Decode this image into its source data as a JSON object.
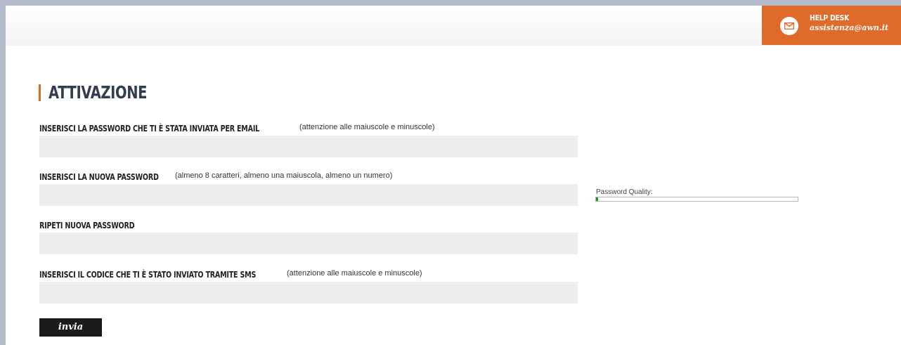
{
  "header": {
    "helpdesk": {
      "title": "HELP DESK",
      "email": "assistenza@awn.it",
      "icon": "mail-icon"
    }
  },
  "page": {
    "title": "ATTIVAZIONE"
  },
  "form": {
    "fields": [
      {
        "label": "INSERISCI LA PASSWORD CHE TI È STATA INVIATA PER EMAIL",
        "hint": "(attenzione alle maiuscole e minuscole)",
        "value": ""
      },
      {
        "label": "INSERISCI LA NUOVA PASSWORD",
        "hint": "(almeno 8 caratteri, almeno una maiuscola, almeno un numero)",
        "value": ""
      },
      {
        "label": "RIPETI NUOVA PASSWORD",
        "hint": "",
        "value": ""
      },
      {
        "label": "INSERISCI IL CODICE CHE TI È STATO INVIATO TRAMITE SMS",
        "hint": "(attenzione alle maiuscole e minuscole)",
        "value": ""
      }
    ],
    "password_quality": {
      "label": "Password Quality:",
      "level": 0.01
    },
    "submit_label": "invia"
  },
  "colors": {
    "accent": "#e06a29",
    "title": "#333d4f",
    "input_bg": "#eeeeee",
    "button_bg": "#1b1b1b",
    "quality_fill": "#1a9a1a",
    "page_border": "#b4bccc"
  }
}
